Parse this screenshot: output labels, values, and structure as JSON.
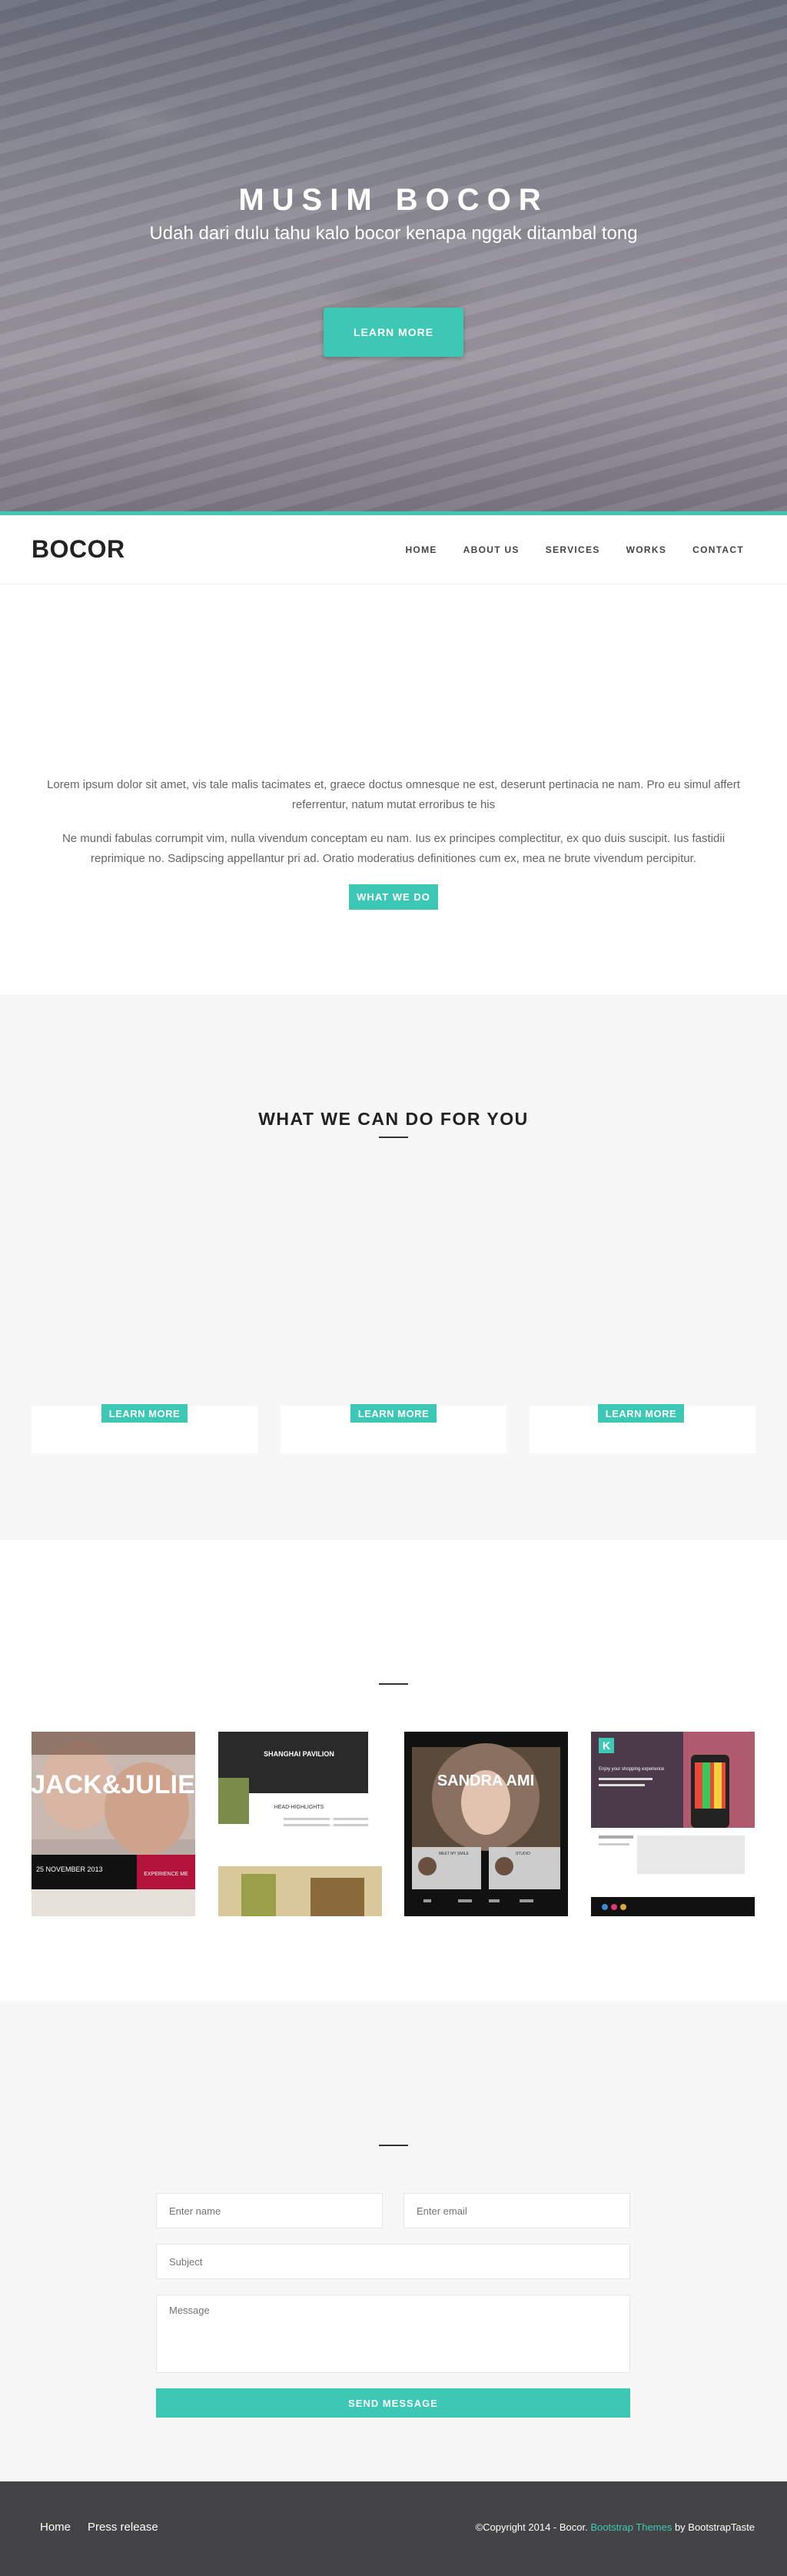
{
  "hero": {
    "title": "MUSIM BOCOR",
    "subtitle": "Udah dari dulu tahu kalo bocor kenapa nggak ditambal tong",
    "cta_label": "LEARN MORE"
  },
  "navbar": {
    "brand": "BOCOR",
    "links": [
      "HOME",
      "ABOUT US",
      "SERVICES",
      "WORKS",
      "CONTACT"
    ]
  },
  "intro": {
    "paragraph_1": "Lorem ipsum dolor sit amet, vis tale malis tacimates et, graece doctus omnesque ne est, deserunt pertinacia ne nam. Pro eu simul affert referrentur, natum mutat erroribus te his",
    "paragraph_2": "Ne mundi fabulas corrumpit vim, nulla vivendum conceptam eu nam. Ius ex principes complectitur, ex quo duis suscipit. Ius fastidii reprimique no. Sadipscing appellantur pri ad. Oratio moderatius definitiones cum ex, mea ne brute vivendum percipitur.",
    "button_label": "WHAT WE DO"
  },
  "services": {
    "title": "WHAT WE CAN DO FOR YOU",
    "cards": [
      {
        "button_label": "LEARN MORE"
      },
      {
        "button_label": "LEARN MORE"
      },
      {
        "button_label": "LEARN MORE"
      }
    ]
  },
  "works": {
    "items": [
      {
        "title": "JACK&JULIE",
        "date": "25 NOVEMBER 2013",
        "tag": "EXPERIENCE ME"
      },
      {
        "title": "SHANGHAI PAVILION",
        "section": "HEAD-HIGHLIGHTS"
      },
      {
        "title": "SANDRA AMI",
        "sub_left": "MEET MY SMILE",
        "sub_right": "STUDIO"
      },
      {
        "title": "K",
        "sub": "Enjoy your shopping experience"
      }
    ]
  },
  "contact": {
    "name_placeholder": "Enter name",
    "email_placeholder": "Enter email",
    "subject_placeholder": "Subject",
    "message_placeholder": "Message",
    "send_label": "SEND MESSAGE"
  },
  "footer": {
    "links": [
      "Home",
      "Press release"
    ],
    "copyright_prefix": "©Copyright 2014 - Bocor. ",
    "copyright_link": "Bootstrap Themes",
    "copyright_suffix": " by BootstrapTaste"
  },
  "colors": {
    "accent": "#3cc8b4",
    "footer_bg": "#444446",
    "section_bg": "#f7f7f7"
  }
}
